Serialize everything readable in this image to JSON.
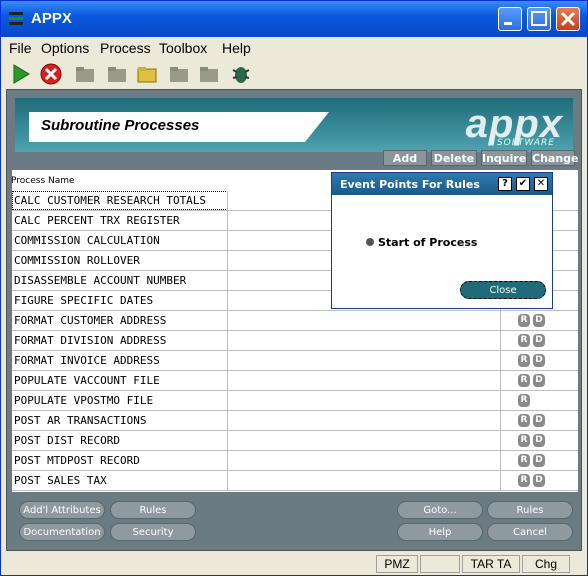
{
  "window": {
    "title": "APPX"
  },
  "menu": [
    "File",
    "Options",
    "Process",
    "Toolbox",
    "Help"
  ],
  "toolbar": [
    "go-icon",
    "stop-icon",
    "folder-icon",
    "folder-open-icon",
    "folder-star-icon",
    "folder-check-icon",
    "folder-x-icon",
    "bug-icon"
  ],
  "header": {
    "title": "Subroutine Processes",
    "logo": "appx",
    "logo_sub": "SOFTWARE"
  },
  "header_buttons": [
    "Add",
    "Delete",
    "Inquire",
    "Change"
  ],
  "table": {
    "column": "Process Name",
    "rows": [
      {
        "name": "CALC CUSTOMER RESEARCH TOTALS",
        "r": false,
        "d": false
      },
      {
        "name": "CALC PERCENT TRX REGISTER",
        "r": false,
        "d": false
      },
      {
        "name": "COMMISSION CALCULATION",
        "r": false,
        "d": false
      },
      {
        "name": "COMMISSION ROLLOVER",
        "r": false,
        "d": false
      },
      {
        "name": "DISASSEMBLE ACCOUNT NUMBER",
        "r": false,
        "d": false
      },
      {
        "name": "FIGURE SPECIFIC DATES",
        "r": false,
        "d": false
      },
      {
        "name": "FORMAT CUSTOMER ADDRESS",
        "r": true,
        "d": true
      },
      {
        "name": "FORMAT DIVISION ADDRESS",
        "r": true,
        "d": true
      },
      {
        "name": "FORMAT INVOICE ADDRESS",
        "r": true,
        "d": true
      },
      {
        "name": "POPULATE VACCOUNT FILE",
        "r": true,
        "d": true
      },
      {
        "name": "POPULATE VPOSTMO FILE",
        "r": true,
        "d": false
      },
      {
        "name": "POST AR TRANSACTIONS",
        "r": true,
        "d": true
      },
      {
        "name": "POST DIST RECORD",
        "r": true,
        "d": true
      },
      {
        "name": "POST MTDPOST RECORD",
        "r": true,
        "d": true
      },
      {
        "name": "POST SALES TAX",
        "r": true,
        "d": true
      }
    ],
    "badge_r": "R",
    "badge_d": "D"
  },
  "bottom_buttons": {
    "left": [
      "Add'l Attributes",
      "Rules",
      "Documentation",
      "Security"
    ],
    "right": [
      "Goto...",
      "Rules",
      "Help",
      "Cancel"
    ]
  },
  "dialog": {
    "title": "Event Points For Rules",
    "help": "?",
    "ok": "✔",
    "x": "✕",
    "item": "Start of Process",
    "close": "Close"
  },
  "status": [
    "PMZ",
    "TAR TA",
    "Chg"
  ]
}
